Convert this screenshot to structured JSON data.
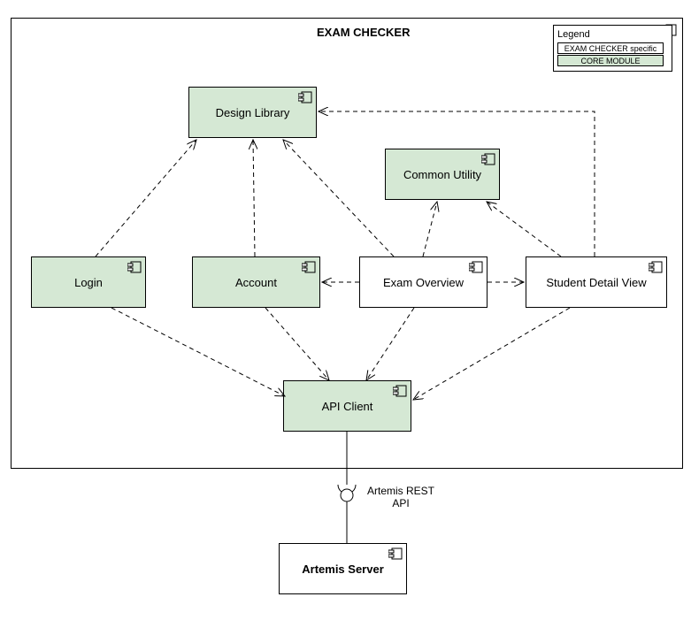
{
  "diagram": {
    "title": "EXAM CHECKER",
    "legend": {
      "title": "Legend",
      "specific": "EXAM CHECKER specific",
      "core": "CORE MODULE"
    },
    "components": {
      "design_library": "Design Library",
      "common_utility": "Common Utility",
      "login": "Login",
      "account": "Account",
      "exam_overview": "Exam Overview",
      "student_detail_view": "Student Detail View",
      "api_client": "API Client",
      "artemis_server": "Artemis Server"
    },
    "interface": {
      "artemis_rest_api": "Artemis REST\nAPI"
    }
  }
}
